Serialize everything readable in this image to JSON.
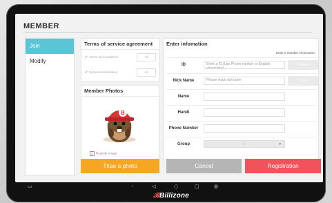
{
  "header": {
    "title": "MEMBER"
  },
  "sidebar": {
    "items": [
      {
        "label": "Join"
      },
      {
        "label": "Modify"
      }
    ]
  },
  "terms": {
    "title": "Terms of service agreement",
    "rows": [
      {
        "label": "Terms and conditions",
        "all_label": "All"
      },
      {
        "label": "Personal information",
        "all_label": "All"
      }
    ]
  },
  "photos": {
    "title": "Member Photos",
    "register_label": "Register Image",
    "take_label": "Tkae a photo"
  },
  "form": {
    "title": "Enter infomation",
    "hint": "Enter a member information.",
    "id": {
      "label": "ID",
      "placeholder": "Enter a ID.(Use Phone number or English characters)",
      "check_label": "Check"
    },
    "nick": {
      "label": "Nick Name",
      "placeholder": "Please input nickname",
      "check_label": "Check"
    },
    "name": {
      "label": "Name"
    },
    "handi": {
      "label": "Handi"
    },
    "phone": {
      "label": "Phone Number"
    },
    "group": {
      "label": "Group",
      "value": "–"
    }
  },
  "actions": {
    "cancel": "Cancel",
    "register": "Registration"
  },
  "brand": {
    "name": "Billizone"
  },
  "colors": {
    "accent": "#5bc5d6",
    "photo_button": "#f5a623",
    "register_button": "#f0535a",
    "cancel_button": "#b5b5b5"
  }
}
